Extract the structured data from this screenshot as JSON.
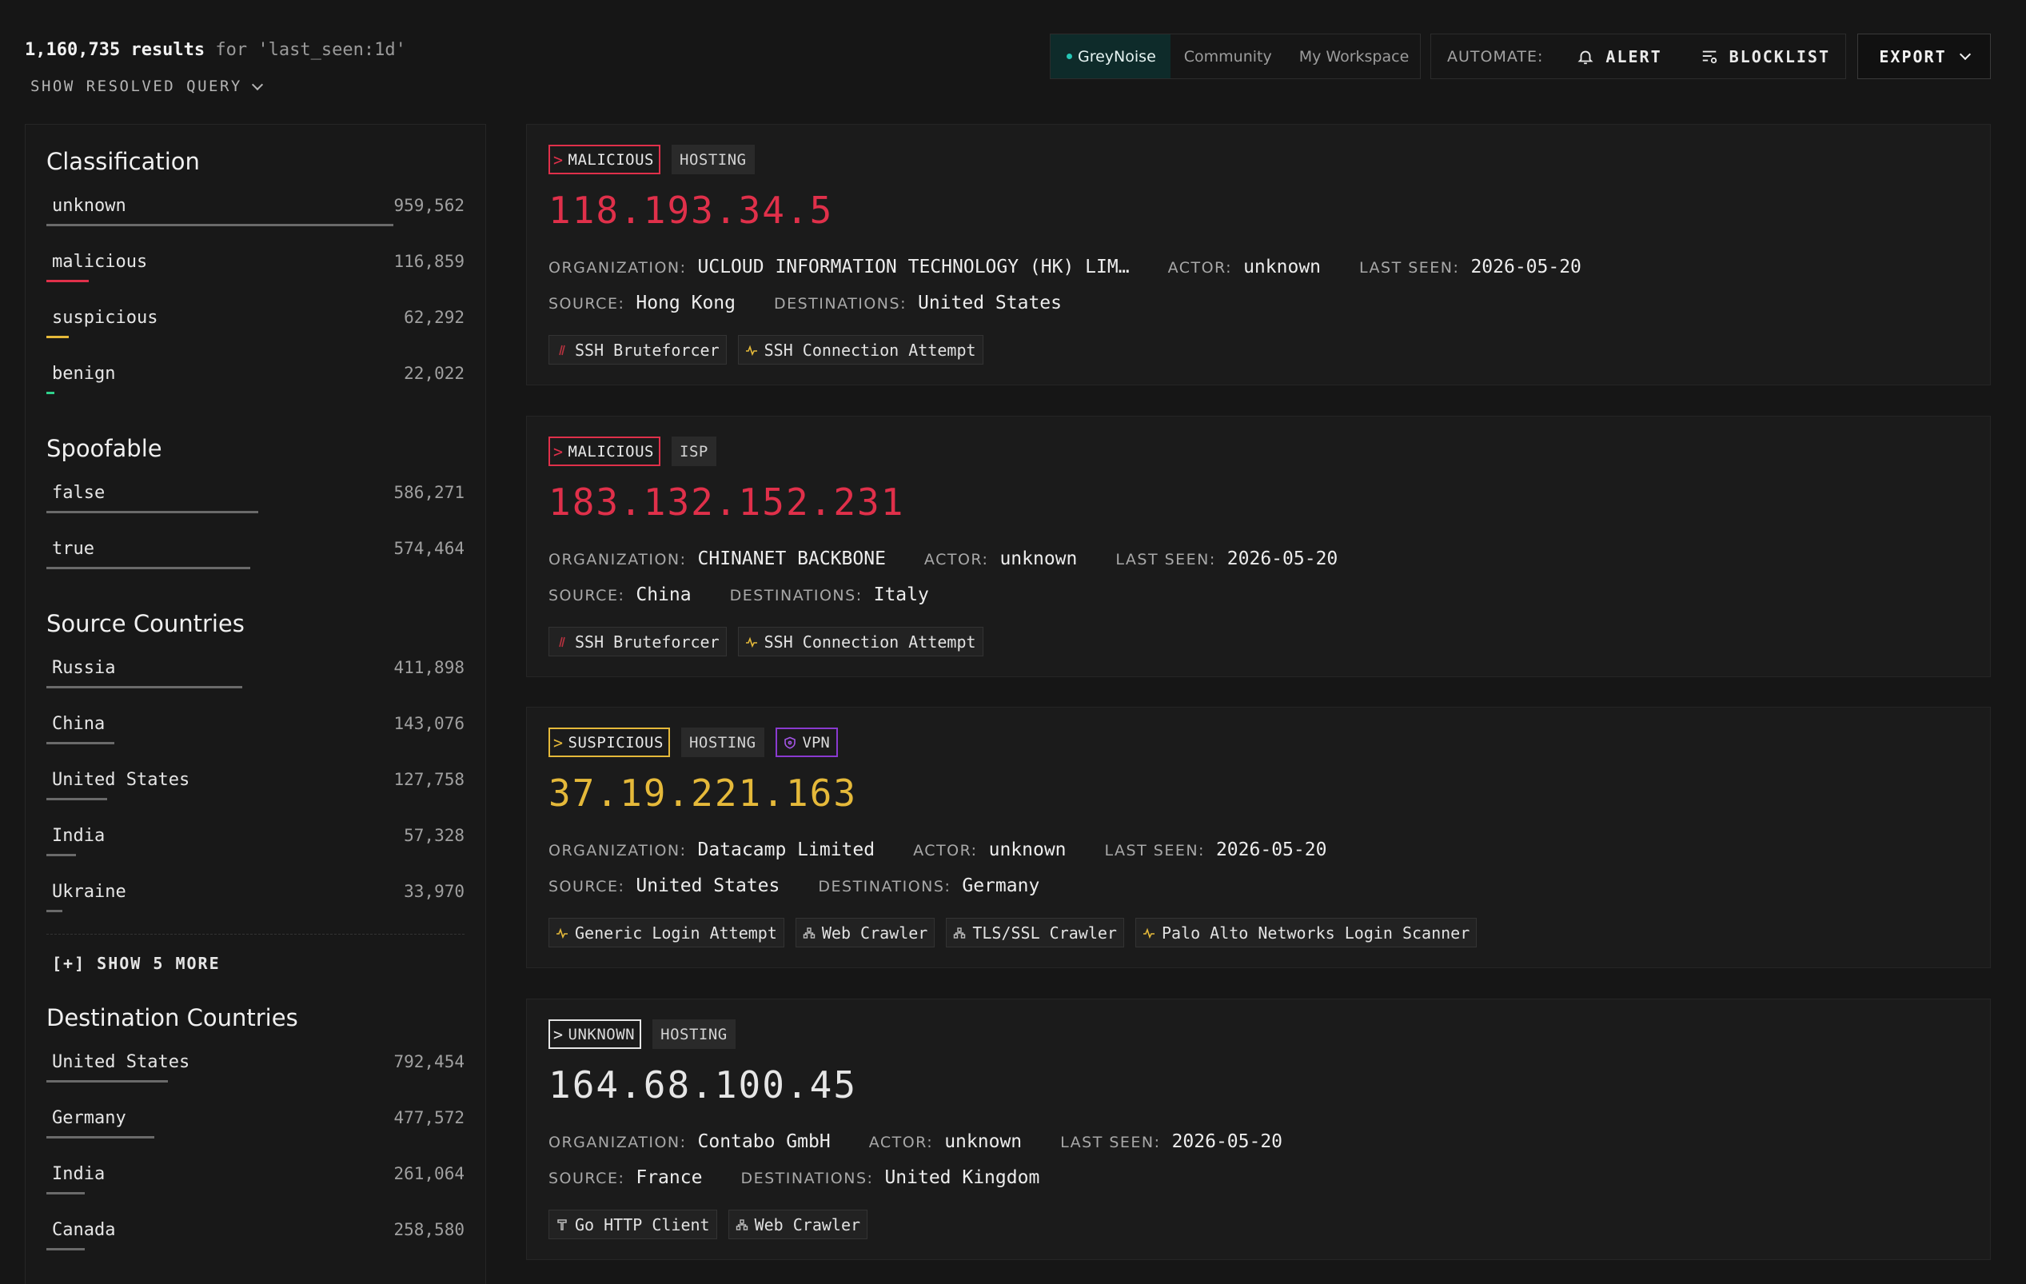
{
  "header": {
    "result_count": "1,160,735 results",
    "query_text": " for 'last_seen:1d'",
    "show_query_label": "SHOW RESOLVED QUERY",
    "workspaces": [
      "GreyNoise",
      "Community",
      "My Workspace"
    ],
    "automate_label": "AUTOMATE:",
    "alert_label": "ALERT",
    "blocklist_label": "BLOCKLIST",
    "export_label": "EXPORT"
  },
  "sidebar": {
    "classification": {
      "title": "Classification",
      "items": [
        {
          "label": "unknown",
          "count": "959,562",
          "share": 1.0,
          "color": "#6a6a6a"
        },
        {
          "label": "malicious",
          "count": "116,859",
          "share": 0.122,
          "color": "#e0304a"
        },
        {
          "label": "suspicious",
          "count": "62,292",
          "share": 0.065,
          "color": "#e5b93a"
        },
        {
          "label": "benign",
          "count": "22,022",
          "share": 0.023,
          "color": "#2fd18b"
        }
      ]
    },
    "spoofable": {
      "title": "Spoofable",
      "items": [
        {
          "label": "false",
          "count": "586,271",
          "share": 0.611
        },
        {
          "label": "true",
          "count": "574,464",
          "share": 0.587
        }
      ]
    },
    "source_countries": {
      "title": "Source Countries",
      "items": [
        {
          "label": "Russia",
          "count": "411,898",
          "share": 0.565
        },
        {
          "label": "China",
          "count": "143,076",
          "share": 0.195
        },
        {
          "label": "United States",
          "count": "127,758",
          "share": 0.175
        },
        {
          "label": "India",
          "count": "57,328",
          "share": 0.085
        },
        {
          "label": "Ukraine",
          "count": "33,970",
          "share": 0.045
        }
      ],
      "show_more_label": "[+] SHOW 5 MORE"
    },
    "destination_countries": {
      "title": "Destination Countries",
      "items": [
        {
          "label": "United States",
          "count": "792,454",
          "share": 0.35
        },
        {
          "label": "Germany",
          "count": "477,572",
          "share": 0.31
        },
        {
          "label": "India",
          "count": "261,064",
          "share": 0.11
        },
        {
          "label": "Canada",
          "count": "258,580",
          "share": 0.11
        }
      ]
    }
  },
  "cards": [
    {
      "classification": "MALICIOUS",
      "class_color": "#e0304a",
      "tags": [
        "HOSTING"
      ],
      "ip": "118.193.34.5",
      "organization": "UCLOUD INFORMATION TECHNOLOGY (HK) LIM…",
      "actor": "unknown",
      "last_seen": "2026-05-20",
      "source": "Hong Kong",
      "destinations": "United States",
      "chips": [
        {
          "label": "SSH Bruteforcer",
          "icon": "malicious-tag-icon"
        },
        {
          "label": "SSH Connection Attempt",
          "icon": "activity-icon"
        }
      ]
    },
    {
      "classification": "MALICIOUS",
      "class_color": "#e0304a",
      "tags": [
        "ISP"
      ],
      "ip": "183.132.152.231",
      "organization": "CHINANET BACKBONE",
      "actor": "unknown",
      "last_seen": "2026-05-20",
      "source": "China",
      "destinations": "Italy",
      "chips": [
        {
          "label": "SSH Bruteforcer",
          "icon": "malicious-tag-icon"
        },
        {
          "label": "SSH Connection Attempt",
          "icon": "activity-icon"
        }
      ]
    },
    {
      "classification": "SUSPICIOUS",
      "class_color": "#e5b93a",
      "tags": [
        "HOSTING"
      ],
      "vpn_label": "VPN",
      "ip": "37.19.221.163",
      "organization": "Datacamp Limited",
      "actor": "unknown",
      "last_seen": "2026-05-20",
      "source": "United States",
      "destinations": "Germany",
      "chips": [
        {
          "label": "Generic Login Attempt",
          "icon": "activity-icon"
        },
        {
          "label": "Web Crawler",
          "icon": "crawler-icon"
        },
        {
          "label": "TLS/SSL Crawler",
          "icon": "crawler-icon"
        },
        {
          "label": "Palo Alto Networks Login Scanner",
          "icon": "activity-icon"
        }
      ]
    },
    {
      "classification": "UNKNOWN",
      "class_color": "#e6e6e6",
      "tags": [
        "HOSTING"
      ],
      "ip": "164.68.100.45",
      "organization": "Contabo GmbH",
      "actor": "unknown",
      "last_seen": "2026-05-20",
      "source": "France",
      "destinations": "United Kingdom",
      "chips": [
        {
          "label": "Go HTTP Client",
          "icon": "tool-icon"
        },
        {
          "label": "Web Crawler",
          "icon": "crawler-icon"
        }
      ]
    }
  ],
  "labels": {
    "organization": "ORGANIZATION:",
    "actor": "ACTOR:",
    "last_seen": "LAST SEEN:",
    "source": "SOURCE:",
    "destinations": "DESTINATIONS:"
  },
  "colors": {
    "malicious": "#e0304a",
    "suspicious": "#e5b93a",
    "benign": "#2fd18b",
    "accent": "#25c6b5",
    "vpn": "#8a3ad0"
  }
}
